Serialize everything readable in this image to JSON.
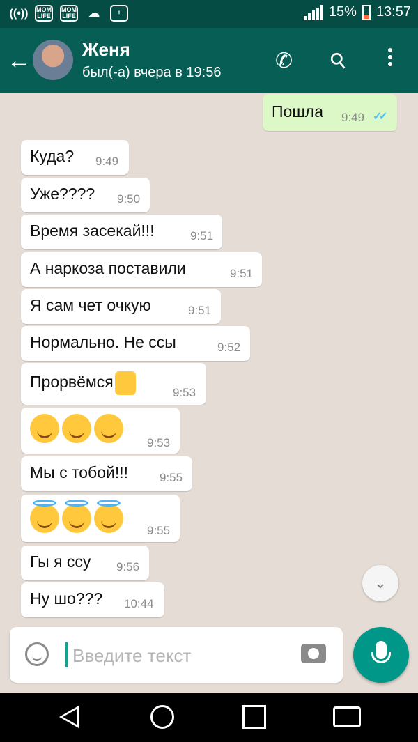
{
  "status_bar": {
    "battery": "15%",
    "time": "13:57",
    "sim1": "MOM LIFE",
    "sim2": "MOM LIFE"
  },
  "header": {
    "contact_name": "Женя",
    "last_seen": "был(-а) вчера в 19:56"
  },
  "messages": [
    {
      "text": "Пошла",
      "time": "9:49",
      "outgoing": true,
      "read": true
    },
    {
      "text": "Куда?",
      "time": "9:49"
    },
    {
      "text": "Уже????",
      "time": "9:50"
    },
    {
      "text": "Время засекай!!!",
      "time": "9:51"
    },
    {
      "text": "А наркоза поставили",
      "time": "9:51"
    },
    {
      "text": "Я сам чет очкую",
      "time": "9:51"
    },
    {
      "text": "Нормально. Не ссы",
      "time": "9:52"
    },
    {
      "text": "Прорвёмся",
      "emoji": "thumbs-up",
      "time": "9:53"
    },
    {
      "emoji": "tears-of-joy x3",
      "time": "9:53"
    },
    {
      "text": "Мы с тобой!!!",
      "time": "9:55"
    },
    {
      "emoji": "smiling-face-with-halo x3",
      "time": "9:55"
    },
    {
      "text": "Гы я ссу",
      "time": "9:56"
    },
    {
      "text": "Ну шо???",
      "time": "10:44"
    }
  ],
  "composer": {
    "placeholder": "Введите текст"
  },
  "colors": {
    "header": "#075e54",
    "status_bar": "#054d44",
    "chat_bg": "#e5ddd5",
    "outgoing_bubble": "#dcf8c6",
    "accent": "#009688"
  }
}
